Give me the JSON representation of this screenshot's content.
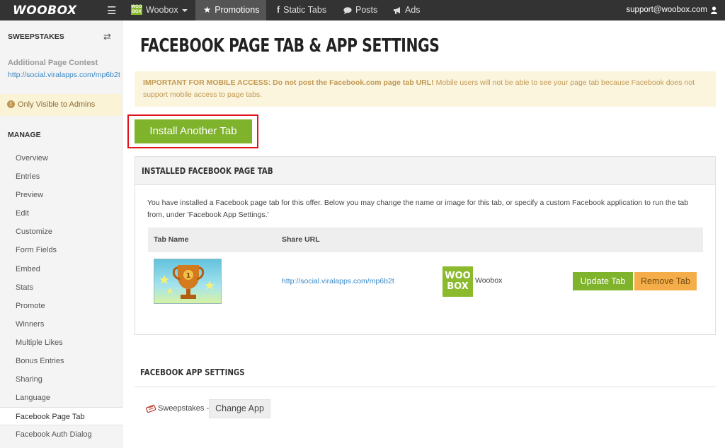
{
  "topbar": {
    "logo": "WOOBOX",
    "menu_icon": "hamburger-icon",
    "account_label": "Woobox",
    "account_logo": "WOO BOX",
    "nav": [
      {
        "label": "Promotions",
        "icon": "star-icon",
        "active": true
      },
      {
        "label": "Static Tabs",
        "icon": "facebook-icon"
      },
      {
        "label": "Posts",
        "icon": "speech-bubble-icon"
      },
      {
        "label": "Ads",
        "icon": "megaphone-icon"
      }
    ],
    "user_email": "support@woobox.com",
    "user_icon": "user-icon"
  },
  "sidebar": {
    "section_title": "SWEEPSTAKES",
    "swap_icon": "swap-arrows-icon",
    "contest_name": "Additional Page Contest",
    "contest_link": "http://social.viralapps.com/mp6b2t",
    "admin_notice": "Only Visible to Admins",
    "manage_title": "MANAGE",
    "items": [
      {
        "label": "Overview"
      },
      {
        "label": "Entries"
      },
      {
        "label": "Preview"
      },
      {
        "label": "Edit"
      },
      {
        "label": "Customize"
      },
      {
        "label": "Form Fields"
      },
      {
        "label": "Embed"
      },
      {
        "label": "Stats"
      },
      {
        "label": "Promote"
      },
      {
        "label": "Winners"
      },
      {
        "label": "Multiple Likes"
      },
      {
        "label": "Bonus Entries"
      },
      {
        "label": "Sharing"
      },
      {
        "label": "Language"
      },
      {
        "label": "Facebook Page Tab",
        "active": true
      },
      {
        "label": "Facebook Auth Dialog"
      }
    ]
  },
  "main": {
    "title": "FACEBOOK PAGE TAB & APP SETTINGS",
    "alert_bold": "IMPORTANT FOR MOBILE ACCESS: Do not post the Facebook.com page tab URL!",
    "alert_text": " Mobile users will not be able to see your page tab because Facebook does not support mobile access to page tabs.",
    "install_button": "Install Another Tab",
    "installed_panel": {
      "title": "INSTALLED FACEBOOK PAGE TAB",
      "description": "You have installed a Facebook page tab for this offer. Below you may change the name or image for this tab, or specify a custom Facebook application to run the tab from, under 'Facebook App Settings.'",
      "col_tab_name": "Tab Name",
      "col_share_url": "Share URL",
      "row": {
        "share_url": "http://social.viralapps.com/mp6b2t",
        "app_logo_text": "WOO BOX",
        "app_name": "Woobox",
        "update_button": "Update Tab",
        "remove_button": "Remove Tab"
      }
    },
    "app_settings": {
      "title": "FACEBOOK APP SETTINGS",
      "app_label": "Sweepstakes -",
      "change_button": "Change App"
    }
  },
  "colors": {
    "topbar_bg": "#333333",
    "green": "#7fb32b",
    "orange": "#f5ad4a",
    "highlight_border": "#e0141a",
    "alert_bg": "#fcf5de",
    "link": "#3a87c4"
  }
}
